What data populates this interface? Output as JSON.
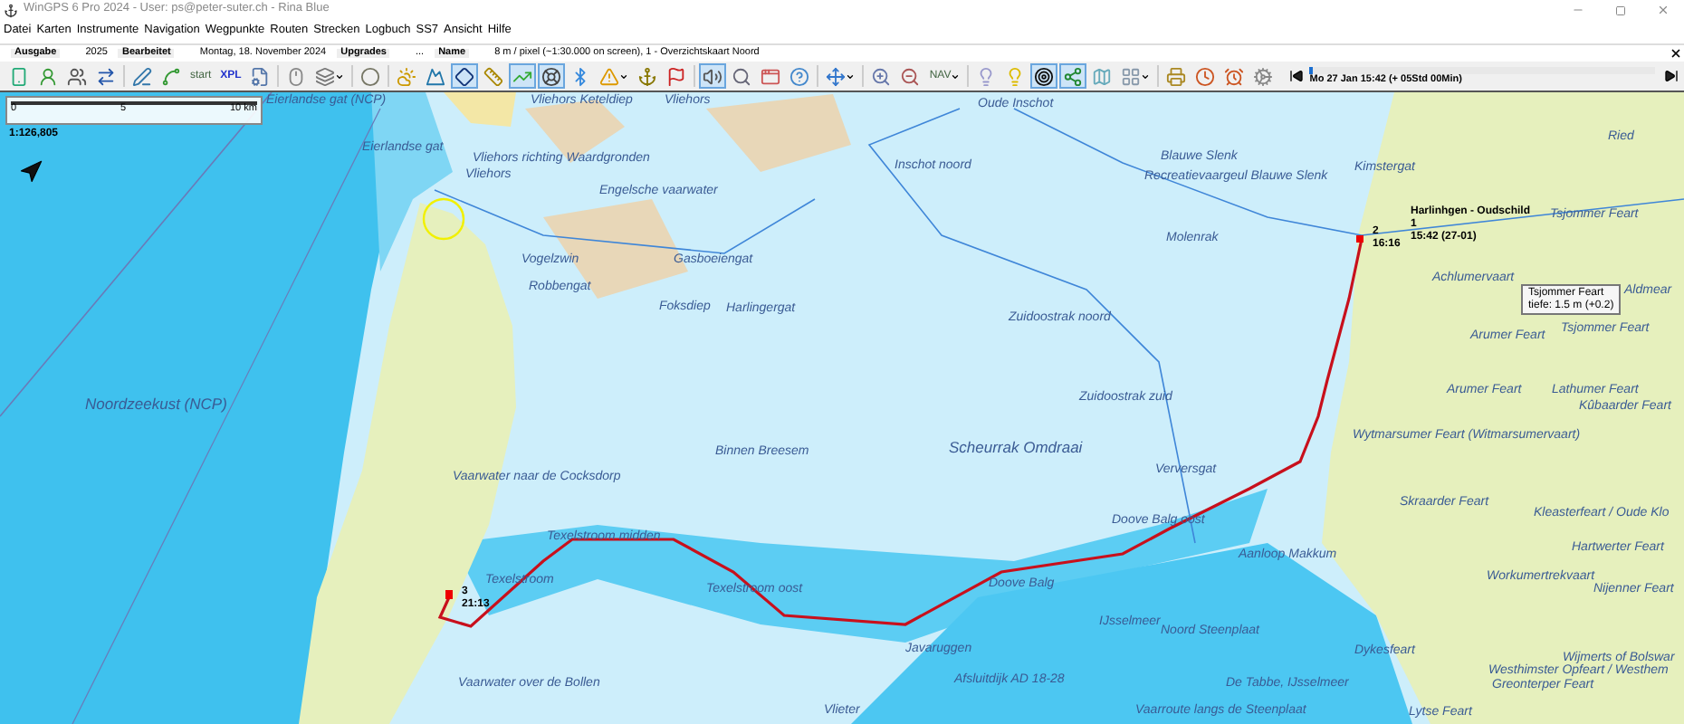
{
  "window": {
    "title": "WinGPS 6 Pro 2024 - User: ps@peter-suter.ch - Rina Blue"
  },
  "menu": [
    "Datei",
    "Karten",
    "Instrumente",
    "Navigation",
    "Wegpunkte",
    "Routen",
    "Strecken",
    "Logbuch",
    "SS7",
    "Ansicht",
    "Hilfe"
  ],
  "info_bar": [
    {
      "label": "Ausgabe",
      "value": "2025"
    },
    {
      "label": "Bearbeitet",
      "value": "Montag, 18. November 2024"
    },
    {
      "label": "Upgrades",
      "value": "..."
    },
    {
      "label": "Name",
      "value": "8 m / pixel (~1:30.000 on screen), 1 - Overzichtskaart Noord"
    }
  ],
  "toolbar": [
    {
      "kind": "icon",
      "selected": false
    },
    {
      "kind": "icon",
      "selected": false
    },
    {
      "kind": "icon",
      "selected": false
    },
    {
      "kind": "icon",
      "selected": false
    },
    {
      "kind": "icon",
      "selected": false
    },
    {
      "kind": "icon",
      "selected": false
    },
    {
      "kind": "text",
      "label": "start",
      "selected": false
    },
    {
      "kind": "text",
      "label": "XPL",
      "selected": false
    },
    {
      "kind": "icon",
      "selected": false
    },
    {
      "kind": "icon",
      "selected": false
    },
    {
      "kind": "icon",
      "selected": false,
      "dropdown": true
    },
    {
      "kind": "icon",
      "selected": false
    },
    {
      "kind": "icon",
      "selected": false
    },
    {
      "kind": "icon",
      "selected": false
    },
    {
      "kind": "icon",
      "selected": true
    },
    {
      "kind": "icon",
      "selected": false
    },
    {
      "kind": "icon",
      "selected": true
    },
    {
      "kind": "icon",
      "selected": true
    },
    {
      "kind": "icon",
      "selected": false
    },
    {
      "kind": "icon",
      "selected": false,
      "dropdown": true
    },
    {
      "kind": "icon",
      "selected": false
    },
    {
      "kind": "icon",
      "selected": false
    },
    {
      "kind": "icon",
      "selected": true
    },
    {
      "kind": "icon",
      "selected": false
    },
    {
      "kind": "icon",
      "selected": false
    },
    {
      "kind": "icon",
      "selected": false
    },
    {
      "kind": "icon",
      "selected": false,
      "dropdown": true
    },
    {
      "kind": "icon",
      "selected": false
    },
    {
      "kind": "icon",
      "selected": false
    },
    {
      "kind": "text",
      "label": "NAV",
      "selected": false,
      "dropdown": true
    },
    {
      "kind": "icon",
      "selected": false
    },
    {
      "kind": "icon",
      "selected": false
    },
    {
      "kind": "icon",
      "selected": true
    },
    {
      "kind": "icon",
      "selected": true
    },
    {
      "kind": "icon",
      "selected": false
    },
    {
      "kind": "icon",
      "selected": false,
      "dropdown": true
    },
    {
      "kind": "icon",
      "selected": false
    },
    {
      "kind": "icon",
      "selected": false
    },
    {
      "kind": "icon",
      "selected": false
    },
    {
      "kind": "icon",
      "selected": false
    }
  ],
  "timeline": {
    "time": "Mo 27 Jan 15:42  (+ 05Std 00Min)",
    "level": 0.0
  },
  "map": {
    "scale_bar": [
      "0",
      "5",
      "10 km"
    ],
    "scale": "1:126,805",
    "labels": [
      {
        "text": "Eierlandse gat (NCP)"
      },
      {
        "text": "Vliehors Keteldiep"
      },
      {
        "text": "Vliehors"
      },
      {
        "text": "Oude Inschot"
      },
      {
        "text": "Eierlandse gat"
      },
      {
        "text": "Vliehors richting Waardgronden"
      },
      {
        "text": "Vliehors"
      },
      {
        "text": "Engelsche vaarwater"
      },
      {
        "text": "Inschot noord"
      },
      {
        "text": "Blauwe Slenk"
      },
      {
        "text": "Recreatievaargeul Blauwe Slenk"
      },
      {
        "text": "Kimstergat"
      },
      {
        "text": "Ried"
      },
      {
        "text": "Tsjommer Feart"
      },
      {
        "text": "Vogelzwin"
      },
      {
        "text": "Robbengat"
      },
      {
        "text": "Gasboeiengat"
      },
      {
        "text": "Foksdiep"
      },
      {
        "text": "Harlingergat"
      },
      {
        "text": "Molenrak"
      },
      {
        "text": "Achlumervaart"
      },
      {
        "text": "Aldmear"
      },
      {
        "text": "Tsjommer Feart"
      },
      {
        "text": "Arumer Feart"
      },
      {
        "text": "Zuidoostrak noord"
      },
      {
        "text": "Zuidoostrak zuid"
      },
      {
        "text": "Arumer Feart"
      },
      {
        "text": "Lathumer Feart"
      },
      {
        "text": "Noordzeekust (NCP)"
      },
      {
        "text": "Kûbaarder Feart"
      },
      {
        "text": "Binnen Breesem"
      },
      {
        "text": "Scheurrak Omdraai"
      },
      {
        "text": "Wytmarsumer Feart (Witmarsumervaart)"
      },
      {
        "text": "Vaarwater naar de Cocksdorp"
      },
      {
        "text": "Verversgat"
      },
      {
        "text": "Skraarder Feart"
      },
      {
        "text": "Doove Balg oost"
      },
      {
        "text": "Kleasterfeart / Oude Klo"
      },
      {
        "text": "Texelstroom midden"
      },
      {
        "text": "Hartwerter Feart"
      },
      {
        "text": "Aanloop Makkum"
      },
      {
        "text": "Texelstroom"
      },
      {
        "text": "Texelstroom oost"
      },
      {
        "text": "Doove Balg"
      },
      {
        "text": "Workumertrekvaart"
      },
      {
        "text": "Nijenner Feart"
      },
      {
        "text": "IJsselmeer"
      },
      {
        "text": "Noord Steenplaat"
      },
      {
        "text": "Javaruggen"
      },
      {
        "text": "Dykesfeart"
      },
      {
        "text": "Vaarwater over de Bollen"
      },
      {
        "text": "Afsluitdijk AD 18-28"
      },
      {
        "text": "De Tabbe, IJsselmeer"
      },
      {
        "text": "Wijmerts of Bolswar"
      },
      {
        "text": "Westhimster Opfeart / Westhem"
      },
      {
        "text": "Greonterper Feart"
      },
      {
        "text": "Vlieter"
      },
      {
        "text": "Vaarroute langs de Steenplaat"
      },
      {
        "text": "Lytse Feart"
      }
    ],
    "route_name": "Harlinhgen - Oudschild",
    "waypoints": [
      {
        "label": "1",
        "time": "15:42 (27-01)"
      },
      {
        "label": "2",
        "time": "16:16"
      },
      {
        "label": "3",
        "time": "21:13"
      }
    ],
    "tooltip": {
      "title": "Tsjommer Feart",
      "detail": "tiefe: 1.5 m (+0.2)"
    }
  }
}
